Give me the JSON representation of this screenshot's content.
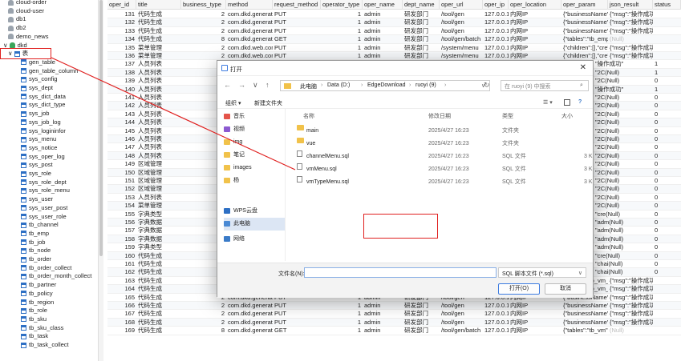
{
  "tree": {
    "dbs": [
      "cloud-order",
      "cloud-user",
      "db1",
      "db2",
      "demo_news",
      "dkd"
    ],
    "table_folder": "表",
    "tables": [
      "gen_table",
      "gen_table_column",
      "sys_config",
      "sys_dept",
      "sys_dict_data",
      "sys_dict_type",
      "sys_job",
      "sys_job_log",
      "sys_logininfor",
      "sys_menu",
      "sys_notice",
      "sys_oper_log",
      "sys_post",
      "sys_role",
      "sys_role_dept",
      "sys_role_menu",
      "sys_user",
      "sys_user_post",
      "sys_user_role",
      "tb_channel",
      "tb_emp",
      "tb_job",
      "tb_node",
      "tb_order",
      "tb_order_collect",
      "tb_order_month_collect",
      "tb_partner",
      "tb_policy",
      "tb_region",
      "tb_role",
      "tb_sku",
      "tb_sku_class",
      "tb_task",
      "tb_task_collect"
    ]
  },
  "grid": {
    "columns": [
      "oper_id",
      "title",
      "business_type",
      "method",
      "request_method",
      "operator_type",
      "oper_name",
      "dept_name",
      "oper_url",
      "oper_ip",
      "oper_location",
      "oper_param",
      "json_result",
      "status"
    ],
    "rows": [
      [
        "131",
        "代码生成",
        "2",
        "com.dkd.generat",
        "PUT",
        "1",
        "admin",
        "研发部门",
        "/tool/gen",
        "127.0.0.1",
        "内网IP",
        "{\"businessName\":",
        "{\"msg\":\"操作成功\"",
        ""
      ],
      [
        "132",
        "代码生成",
        "2",
        "com.dkd.generat",
        "PUT",
        "1",
        "admin",
        "研发部门",
        "/tool/gen",
        "127.0.0.1",
        "内网IP",
        "{\"businessName\":",
        "{\"msg\":\"操作成功\"",
        ""
      ],
      [
        "133",
        "代码生成",
        "2",
        "com.dkd.generat",
        "PUT",
        "1",
        "admin",
        "研发部门",
        "/tool/gen",
        "127.0.0.1",
        "内网IP",
        "{\"businessName\":",
        "{\"msg\":\"操作成功\"",
        ""
      ],
      [
        "134",
        "代码生成",
        "8",
        "com.dkd.generat",
        "GET",
        "1",
        "admin",
        "研发部门",
        "/tool/gen/batch",
        "127.0.0.1",
        "内网IP",
        "{\"tables\":\"tb_emp\"",
        "(Null)",
        ""
      ],
      [
        "135",
        "菜单管理",
        "2",
        "com.dkd.web.cor",
        "PUT",
        "1",
        "admin",
        "研发部门",
        "/system/menu",
        "127.0.0.1",
        "内网IP",
        "{\"children\":[],\"cre\"",
        "{\"msg\":\"操作成功\"",
        ""
      ],
      [
        "136",
        "菜单管理",
        "2",
        "com.dkd.web.cor",
        "PUT",
        "1",
        "admin",
        "研发部门",
        "/system/menu",
        "127.0.0.1",
        "内网IP",
        "{\"children\":[],\"cre\"",
        "{\"msg\":\"操作成功\"",
        ""
      ],
      [
        "137",
        "人员列表",
        "",
        "",
        "",
        "",
        "",
        "",
        "",
        "",
        "",
        "",
        "",
        "1"
      ],
      [
        "138",
        "人员列表",
        "",
        "",
        "",
        "",
        "",
        "",
        "",
        "",
        "",
        "",
        "",
        "1"
      ],
      [
        "139",
        "人员列表",
        "",
        "",
        "",
        "",
        "",
        "",
        "",
        "",
        "",
        "",
        "",
        "0"
      ],
      [
        "140",
        "人员列表",
        "",
        "",
        "",
        "",
        "",
        "",
        "",
        "",
        "",
        "",
        "",
        "1"
      ],
      [
        "141",
        "人员列表",
        "",
        "",
        "",
        "",
        "",
        "",
        "",
        "",
        "",
        "",
        "",
        "0"
      ],
      [
        "142",
        "人员列表",
        "",
        "",
        "",
        "",
        "",
        "",
        "",
        "",
        "",
        "",
        "",
        "0"
      ],
      [
        "143",
        "人员列表",
        "",
        "",
        "",
        "",
        "",
        "",
        "",
        "",
        "",
        "",
        "",
        "0"
      ],
      [
        "144",
        "人员列表",
        "",
        "",
        "",
        "",
        "",
        "",
        "",
        "",
        "",
        "",
        "",
        "0"
      ],
      [
        "145",
        "人员列表",
        "",
        "",
        "",
        "",
        "",
        "",
        "",
        "",
        "",
        "",
        "",
        "0"
      ],
      [
        "146",
        "人员列表",
        "",
        "",
        "",
        "",
        "",
        "",
        "",
        "",
        "",
        "",
        "",
        "0"
      ],
      [
        "147",
        "人员列表",
        "",
        "",
        "",
        "",
        "",
        "",
        "",
        "",
        "",
        "",
        "",
        "0"
      ],
      [
        "148",
        "人员列表",
        "",
        "",
        "",
        "",
        "",
        "",
        "",
        "",
        "",
        "",
        "",
        "0"
      ],
      [
        "149",
        "区域管理",
        "",
        "",
        "",
        "",
        "",
        "",
        "",
        "",
        "",
        "",
        "",
        "0"
      ],
      [
        "150",
        "区域管理",
        "",
        "",
        "",
        "",
        "",
        "",
        "",
        "",
        "",
        "",
        "",
        "0"
      ],
      [
        "151",
        "区域管理",
        "",
        "",
        "",
        "",
        "",
        "",
        "",
        "",
        "",
        "",
        "",
        "0"
      ],
      [
        "152",
        "区域管理",
        "",
        "",
        "",
        "",
        "",
        "",
        "",
        "",
        "",
        "",
        "",
        "0"
      ],
      [
        "153",
        "人员列表",
        "",
        "",
        "",
        "",
        "",
        "",
        "",
        "",
        "",
        "",
        "",
        "0"
      ],
      [
        "154",
        "菜单管理",
        "",
        "",
        "",
        "",
        "",
        "",
        "",
        "",
        "",
        "",
        "",
        "0"
      ],
      [
        "155",
        "字典类型",
        "",
        "",
        "",
        "",
        "",
        "",
        "",
        "",
        "",
        "",
        "",
        "0"
      ],
      [
        "156",
        "字典数据",
        "",
        "",
        "",
        "",
        "",
        "",
        "",
        "",
        "",
        "",
        "",
        "0"
      ],
      [
        "157",
        "字典数据",
        "",
        "",
        "",
        "",
        "",
        "",
        "",
        "",
        "",
        "",
        "",
        "0"
      ],
      [
        "158",
        "字典数据",
        "",
        "",
        "",
        "",
        "",
        "",
        "",
        "",
        "",
        "",
        "",
        "0"
      ],
      [
        "159",
        "字典类型",
        "",
        "",
        "",
        "",
        "",
        "",
        "",
        "",
        "",
        "",
        "",
        "0"
      ],
      [
        "160",
        "代码生成",
        "",
        "",
        "",
        "",
        "",
        "",
        "",
        "",
        "",
        "",
        "",
        "0"
      ],
      [
        "161",
        "代码生成",
        "",
        "",
        "",
        "",
        "",
        "",
        "",
        "",
        "",
        "",
        "",
        "0"
      ],
      [
        "162",
        "代码生成",
        "",
        "",
        "",
        "",
        "",
        "",
        "",
        "",
        "",
        "",
        "",
        "0"
      ],
      [
        "163",
        "代码生成",
        "6",
        "com.dkd.generat",
        "POST",
        "1",
        "admin",
        "研发部门",
        "/tool/gen/import",
        "127.0.0.1",
        "内网IP",
        "{\"tables\":\"tb_vm_\"",
        "{\"msg\":\"操作成功\"",
        ""
      ],
      [
        "164",
        "代码生成",
        "6",
        "com.dkd.generat",
        "POST",
        "1",
        "admin",
        "研发部门",
        "/tool/gen/import",
        "127.0.0.1",
        "内网IP",
        "{\"tables\":\"tb_vm_\"",
        "{\"msg\":\"操作成功\"",
        ""
      ],
      [
        "165",
        "代码生成",
        "2",
        "com.dkd.generat",
        "PUT",
        "1",
        "admin",
        "研发部门",
        "/tool/gen",
        "127.0.0.1",
        "内网IP",
        "{\"businessName\":",
        "{\"msg\":\"操作成功\"",
        ""
      ],
      [
        "166",
        "代码生成",
        "2",
        "com.dkd.generat",
        "PUT",
        "1",
        "admin",
        "研发部门",
        "/tool/gen",
        "127.0.0.1",
        "内网IP",
        "{\"businessName\":",
        "{\"msg\":\"操作成功\"",
        ""
      ],
      [
        "167",
        "代码生成",
        "2",
        "com.dkd.generat",
        "PUT",
        "1",
        "admin",
        "研发部门",
        "/tool/gen",
        "127.0.0.1",
        "内网IP",
        "{\"businessName\":",
        "{\"msg\":\"操作成功\"",
        ""
      ],
      [
        "168",
        "代码生成",
        "2",
        "com.dkd.generat",
        "PUT",
        "1",
        "admin",
        "研发部门",
        "/tool/gen",
        "127.0.0.1",
        "内网IP",
        "{\"businessName\":",
        "{\"msg\":\"操作成功\"",
        ""
      ],
      [
        "169",
        "代码生成",
        "8",
        "com.dkd.generat",
        "GET",
        "1",
        "admin",
        "研发部门",
        "/tool/gen/batch",
        "127.0.0.1",
        "内网IP",
        "{\"tables\":\"tb_vm\"",
        "(Null)",
        ""
      ]
    ],
    "trailing_right": [
      "\"操作成功\"",
      "\"2C(Null)",
      "\"2C(Null)",
      "\"操作成功\"",
      "\"2C(Null)",
      "\"2C(Null)",
      "\"2C(Null)",
      "\"2C(Null)",
      "\"2C(Null)",
      "\"2C(Null)",
      "\"2C(Null)",
      "\"2C(Null)",
      "\"2C(Null)",
      "\"2C(Null)",
      "\"2C(Null)",
      "\"2C(Null)",
      "\"2C(Null)",
      "\"2C(Null)",
      "\"cre(Null)",
      "\"adm(Null)",
      "\"adm(Null)",
      "\"adm(Null)",
      "\"adm(Null)",
      "\"cre(Null)",
      "\"chai(Null)",
      "\"chai(Null)"
    ]
  },
  "dialog": {
    "title": "打开",
    "close": "✕",
    "breadcrumb": [
      "此电脑",
      "Data (D:)",
      "EdgeDownload",
      "ruoyi (9)"
    ],
    "search_placeholder": "在 ruoyi (9) 中搜索",
    "organize": "组织 ▾",
    "new_folder": "新建文件夹",
    "side": [
      "音乐",
      "视频",
      "img",
      "笔记",
      "images",
      "杨",
      "WPS云盘",
      "此电脑",
      "网络"
    ],
    "headers": [
      "名称",
      "修改日期",
      "类型",
      "大小"
    ],
    "files": [
      {
        "name": "main",
        "date": "2025/4/27 16:23",
        "type": "文件夹",
        "size": "",
        "kind": "folder"
      },
      {
        "name": "vue",
        "date": "2025/4/27 16:23",
        "type": "文件夹",
        "size": "",
        "kind": "folder"
      },
      {
        "name": "channelMenu.sql",
        "date": "2025/4/27 16:23",
        "type": "SQL 文件",
        "size": "3 K",
        "kind": "file"
      },
      {
        "name": "vmMenu.sql",
        "date": "2025/4/27 16:23",
        "type": "SQL 文件",
        "size": "3 K",
        "kind": "file"
      },
      {
        "name": "vmTypeMenu.sql",
        "date": "2025/4/27 16:23",
        "type": "SQL 文件",
        "size": "3 K",
        "kind": "file"
      }
    ],
    "filename_label": "文件名(N):",
    "filename_value": "",
    "filetype": "SQL 脚本文件 (*.sql)",
    "open_btn": "打开(O)",
    "cancel_btn": "取消"
  }
}
